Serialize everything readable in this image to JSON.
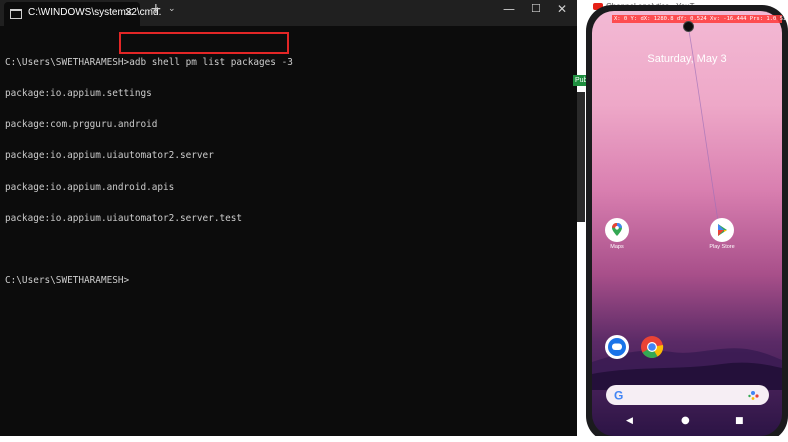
{
  "terminal": {
    "tab_title": "C:\\WINDOWS\\system32\\cmd.",
    "tab_close": "✕",
    "new_tab": "+",
    "dropdown": "⌄",
    "minimize": "—",
    "maximize": "☐",
    "close": "✕",
    "prompt": "C:\\Users\\SWETHARAMESH>",
    "command": "adb shell pm list packages -3",
    "output": [
      "package:io.appium.settings",
      "package:com.prgguru.android",
      "package:io.appium.uiautomator2.server",
      "package:io.appium.android.apis",
      "package:io.appium.uiautomator2.server.test"
    ],
    "final_prompt": "C:\\Users\\SWETHARAMESH>"
  },
  "browser": {
    "tab_title": "Channel analytics - YouT",
    "chip": "Pub"
  },
  "phone": {
    "status_text": "X: 0    Y:   dX: 1280.8  dY: 0.524  Xv: -16.444  Prs: 1.0    Size: 0",
    "date": "Saturday, May 3",
    "apps": {
      "maps": "Maps",
      "play": "Play Store",
      "messages": "",
      "chrome": ""
    },
    "nav": {
      "back": "◀",
      "home": "●",
      "recent": "■"
    }
  },
  "colors": {
    "highlight_box": "#e32626",
    "terminal_bg": "#0c0c0c",
    "terminal_text": "#cccccc"
  }
}
